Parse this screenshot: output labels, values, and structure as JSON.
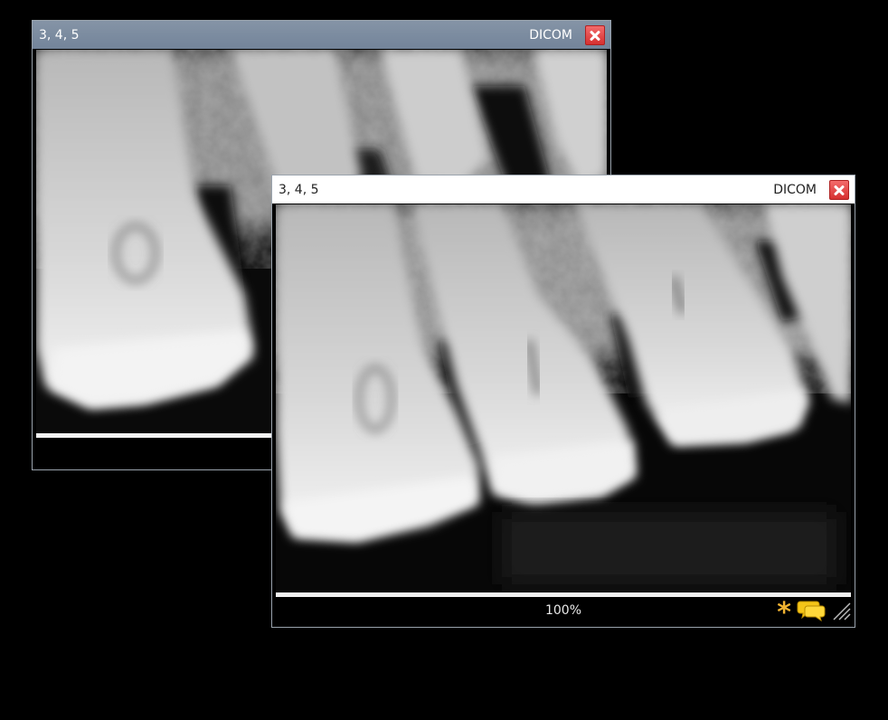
{
  "windows": [
    {
      "title": "3, 4, 5",
      "format_label": "DICOM",
      "state": "inactive"
    },
    {
      "title": "3, 4, 5",
      "format_label": "DICOM",
      "state": "active",
      "zoom": "100%"
    }
  ],
  "icons": {
    "close": "close-icon",
    "annotation": "asterisk-icon",
    "comments": "speech-bubble-icon",
    "resize": "resize-grip-icon"
  },
  "colors": {
    "background": "#000000",
    "inactive_titlebar": "#7b8ba0",
    "active_titlebar": "#ffffff",
    "close_button": "#e04545",
    "annotation_icon": "#f2b431",
    "comments_icon": "#f5c518"
  }
}
